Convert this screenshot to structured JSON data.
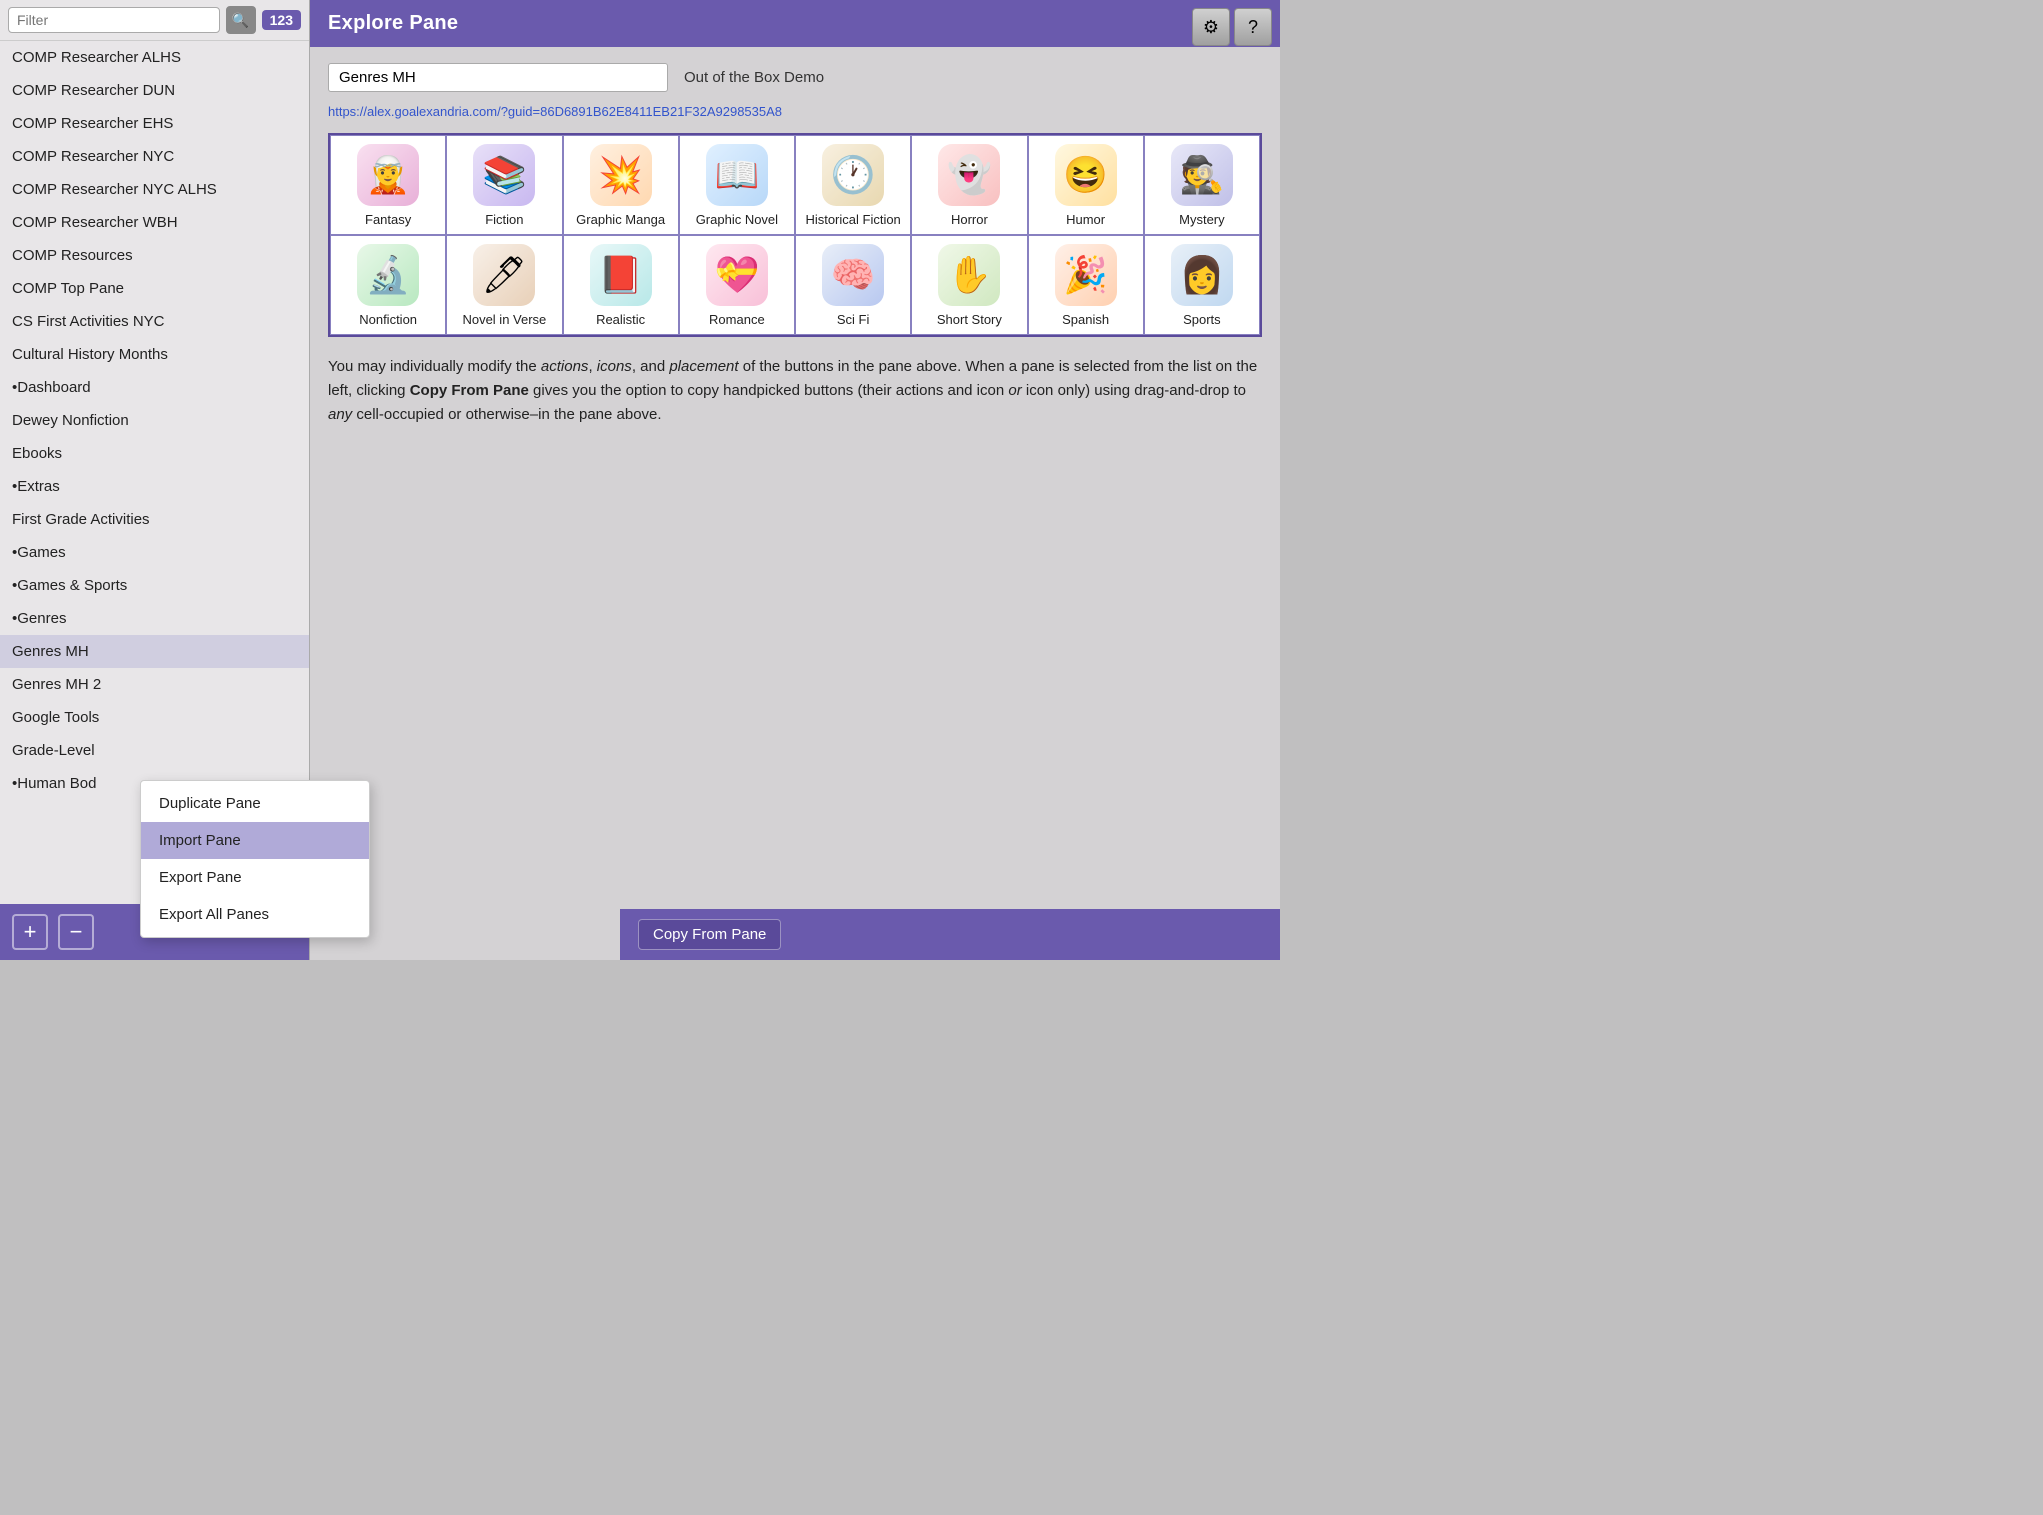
{
  "topIcons": {
    "settingsLabel": "⚙",
    "helpLabel": "?"
  },
  "sidebar": {
    "searchPlaceholder": "Filter",
    "count": "123",
    "items": [
      {
        "label": "COMP Researcher ALHS",
        "active": false
      },
      {
        "label": "COMP Researcher DUN",
        "active": false
      },
      {
        "label": "COMP Researcher EHS",
        "active": false
      },
      {
        "label": "COMP Researcher NYC",
        "active": false
      },
      {
        "label": "COMP Researcher NYC ALHS",
        "active": false
      },
      {
        "label": "COMP Researcher WBH",
        "active": false
      },
      {
        "label": "COMP Resources",
        "active": false
      },
      {
        "label": "COMP Top Pane",
        "active": false
      },
      {
        "label": "CS First Activities NYC",
        "active": false
      },
      {
        "label": "Cultural History Months",
        "active": false
      },
      {
        "label": "•Dashboard",
        "active": false
      },
      {
        "label": "Dewey Nonfiction",
        "active": false
      },
      {
        "label": "Ebooks",
        "active": false
      },
      {
        "label": "•Extras",
        "active": false
      },
      {
        "label": "First Grade Activities",
        "active": false
      },
      {
        "label": "•Games",
        "active": false
      },
      {
        "label": "•Games & Sports",
        "active": false
      },
      {
        "label": "•Genres",
        "active": false
      },
      {
        "label": "Genres MH",
        "active": true
      },
      {
        "label": "Genres MH 2",
        "active": false
      },
      {
        "label": "Google Tools",
        "active": false
      },
      {
        "label": "Grade-Level",
        "active": false
      },
      {
        "label": "•Human Bod",
        "active": false
      }
    ],
    "addLabel": "+",
    "removeLabel": "−"
  },
  "explorePane": {
    "title": "Explore Pane",
    "paneName": "Genres MH",
    "paneOwner": "Out of the Box Demo",
    "paneLink": "https://alex.goalexandria.com/?guid=86D6891B62E8411EB21F32A9298535A8",
    "genres": [
      {
        "label": "Fantasy",
        "icon": "🧝",
        "iconClass": "icon-fantasy"
      },
      {
        "label": "Fiction",
        "icon": "📚",
        "iconClass": "icon-fiction"
      },
      {
        "label": "Graphic Manga",
        "icon": "💥",
        "iconClass": "icon-graphic-manga"
      },
      {
        "label": "Graphic Novel",
        "icon": "📖",
        "iconClass": "icon-graphic-novel"
      },
      {
        "label": "Historical Fiction",
        "icon": "🕐",
        "iconClass": "icon-historical"
      },
      {
        "label": "Horror",
        "icon": "👻",
        "iconClass": "icon-horror"
      },
      {
        "label": "Humor",
        "icon": "😆",
        "iconClass": "icon-humor"
      },
      {
        "label": "Mystery",
        "icon": "🕵",
        "iconClass": "icon-mystery"
      },
      {
        "label": "Nonfiction",
        "icon": "🔬",
        "iconClass": "icon-nonfiction"
      },
      {
        "label": "Novel in Verse",
        "icon": "🖊",
        "iconClass": "icon-novel-verse"
      },
      {
        "label": "Realistic",
        "icon": "📕",
        "iconClass": "icon-realistic"
      },
      {
        "label": "Romance",
        "icon": "💝",
        "iconClass": "icon-romance"
      },
      {
        "label": "Sci Fi",
        "icon": "🧠",
        "iconClass": "icon-scifi"
      },
      {
        "label": "Short Story",
        "icon": "✋",
        "iconClass": "icon-short-story"
      },
      {
        "label": "Spanish",
        "icon": "🎉",
        "iconClass": "icon-spanish"
      },
      {
        "label": "Sports",
        "icon": "👩",
        "iconClass": "icon-sports"
      }
    ],
    "description": "You may individually modify the actions, icons, and placement of the buttons in the pane above. When a pane is selected from the list on the left, clicking Copy From Pane gives you the option to copy handpicked buttons (their actions and icon or icon only) using drag-and-drop to any cell-occupied or otherwise–in the pane above.",
    "copyPaneLabel": "Copy From Pane"
  },
  "contextMenu": {
    "items": [
      {
        "label": "Duplicate Pane",
        "highlighted": false
      },
      {
        "label": "Import Pane",
        "highlighted": true
      },
      {
        "label": "Export Pane",
        "highlighted": false
      },
      {
        "label": "Export All Panes",
        "highlighted": false
      }
    ]
  }
}
